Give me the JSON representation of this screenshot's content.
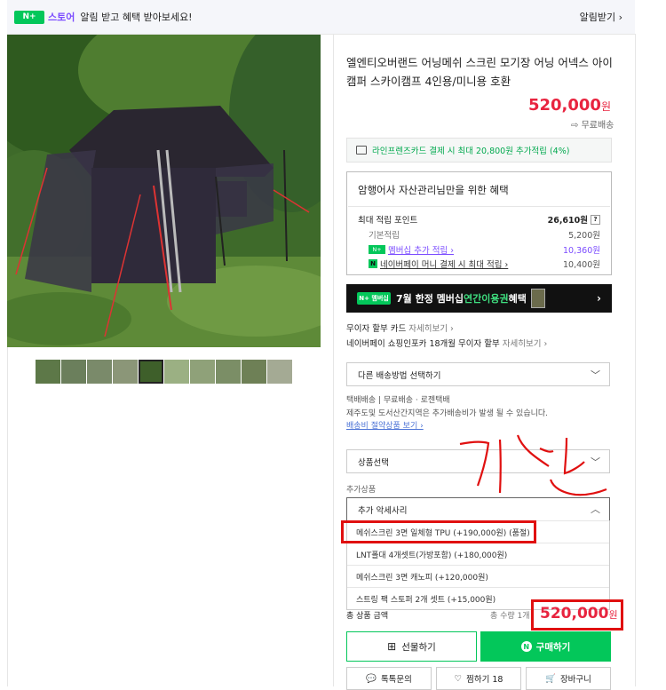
{
  "topbar": {
    "badge": "N+",
    "store": "스토어",
    "message": "알림 받고 혜택 받아보세요!",
    "subscribe": "알림받기 ›"
  },
  "product": {
    "title": "엘엔티오버랜드 어닝메쉬 스크린 모기장 어닝 어넥스 아이캠퍼 스카이캠프 4인용/미니용 호환",
    "price": "520,000",
    "price_unit": "원",
    "shipping_badge": "무료배송"
  },
  "card_promo": "라인프렌즈카드 결제 시 최대 20,800원 추가적립 (4%)",
  "benefit": {
    "title": "암행어사 자산관리님만을 위한 혜택",
    "max_label": "최대 적립 포인트",
    "max_value": "26,610원",
    "rows": [
      {
        "label": "기본적립",
        "value": "5,200원"
      },
      {
        "label": "멤버십 추가 적립 ›",
        "value": "10,360원"
      },
      {
        "label": "네이버페이 머니 결제 시 최대 적립 ›",
        "value": "10,400원"
      }
    ]
  },
  "banner": {
    "badge": "N+ 멤버십",
    "text_prefix": "7월 한정 멤버십 ",
    "text_accent": "연간이용권",
    "text_suffix": " 혜택",
    "arrow": "›"
  },
  "installment": {
    "line1_label": "무이자 할부 카드",
    "line1_link": "자세히보기 ›",
    "line2_label": "네이버페이 쇼핑인포카 18개월 무이자 할부",
    "line2_link": "자세히보기 ›"
  },
  "shipping_select": "다른 배송방법 선택하기",
  "shipping_info": {
    "line1": "택배배송  |  무료배송 · 로젠택배",
    "line2": "제주도및 도서산간지역은 추가배송비가 발생 될 수 있습니다.",
    "link": "배송비 절약상품 보기 ›"
  },
  "option_select": "상품선택",
  "additional_label": "추가상품",
  "accessory_select": "추가 악세사리",
  "dropdown_items": [
    "메쉬스크린 3면 일체형 TPU (+190,000원) (품절)",
    "LNT폴대 4개셋트(가방포함) (+180,000원)",
    "메쉬스크린 3면 캐노피 (+120,000원)",
    "스트링 팩 스토퍼 2개 셋트 (+15,000원)"
  ],
  "total": {
    "label": "총 상품 금액",
    "qty": "총 수량 1개",
    "price": "520,000",
    "unit": "원"
  },
  "buttons": {
    "gift": "선물하기",
    "buy": "구매하기",
    "talk": "톡톡문의",
    "wish": "찜하기 18",
    "cart": "장바구니"
  },
  "annotation": "기만",
  "colors": {
    "accent_green": "#03c75a",
    "price_red": "#e8243f",
    "annotation_red": "#e01010"
  }
}
